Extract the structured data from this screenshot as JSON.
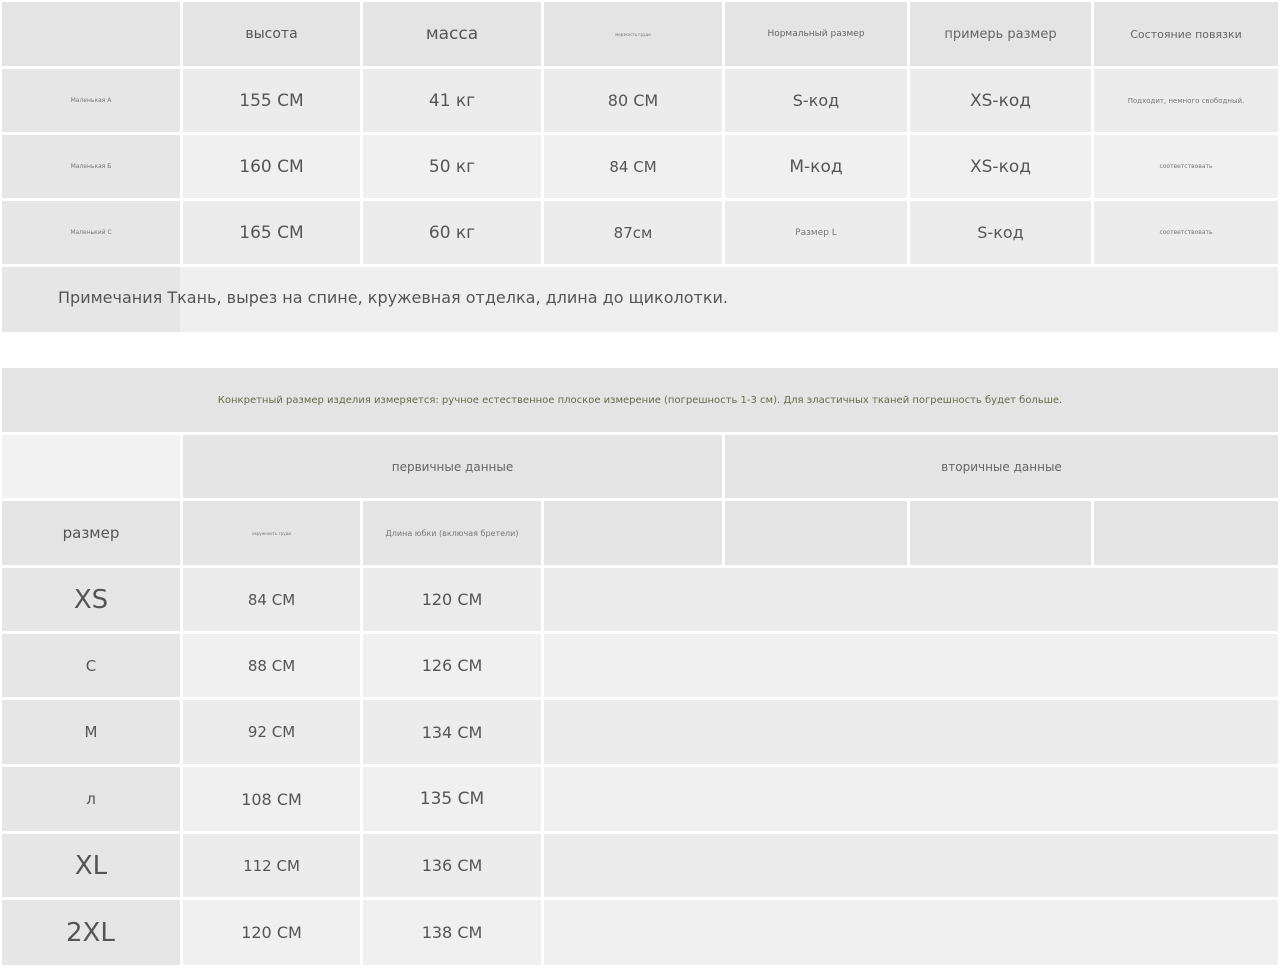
{
  "table1": {
    "headers": [
      "",
      "высота",
      "масса",
      "мерзкость груди",
      "Нормальный размер",
      "примерь размер",
      "Состояние повязки"
    ],
    "rows": [
      [
        "Маленькая A",
        "155 СМ",
        "41 кг",
        "80 СМ",
        "S-код",
        "XS-код",
        "Подходит, немного свободный."
      ],
      [
        "Маленькая Б",
        "160 СМ",
        "50 кг",
        "84 СМ",
        "М-код",
        "XS-код",
        "соответствовать"
      ],
      [
        "Маленький С",
        "165 СМ",
        "60 кг",
        "87см",
        "Размер L",
        "S-код",
        "соответствовать"
      ]
    ],
    "note": "Примечания Ткань, вырез на спине, кружевная отделка, длина до щиколотки."
  },
  "table2": {
    "measure_note": "Конкретный размер изделия измеряется: ручное естественное плоское измерение (погрешность 1-3 см). Для эластичных тканей погрешность будет больше.",
    "group_primary": "первичные данные",
    "group_secondary": "вторичные данные",
    "col_size": "размер",
    "col_chest": "окружность груди",
    "col_length": "Длина юбки (включая бретели)",
    "rows": [
      [
        "XS",
        "84 СМ",
        "120 СМ"
      ],
      [
        "С",
        "88 СМ",
        "126 СМ"
      ],
      [
        "М",
        "92 СМ",
        "134 СМ"
      ],
      [
        "л",
        "108 СМ",
        "135 СМ"
      ],
      [
        "XL",
        "112 СМ",
        "136 СМ"
      ],
      [
        "2XL",
        "120 СМ",
        "138 СМ"
      ]
    ]
  }
}
